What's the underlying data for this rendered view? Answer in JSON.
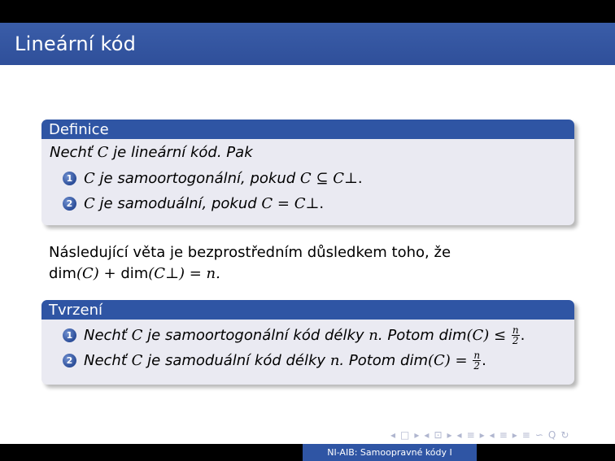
{
  "slide": {
    "title": "Lineární kód"
  },
  "definition": {
    "header": "Definice",
    "intro_text": "Nechť",
    "intro_var": "C",
    "intro_rest": "je lineární kód. Pak",
    "items": [
      {
        "num": "1",
        "var": "C",
        "text": "je samoortogonální, pokud",
        "math": "C ⊆ C⊥",
        "end": "."
      },
      {
        "num": "2",
        "var": "C",
        "text": "je samoduální, pokud",
        "math": "C = C⊥",
        "end": "."
      }
    ]
  },
  "paragraph": {
    "line1": "Následující věta je bezprostředním důsledkem toho, že",
    "line2_dim1": "dim",
    "line2_mid": "(C) + ",
    "line2_dim2": "dim",
    "line2_end": "(C⊥) = n."
  },
  "statement": {
    "header": "Tvrzení",
    "items": [
      {
        "num": "1",
        "pre": "Nechť",
        "var": "C",
        "text": "je samoortogonální kód délky",
        "n": "n",
        "post": ". Potom dim",
        "math": "(C) ≤",
        "frac_num": "n",
        "frac_den": "2",
        "end": "."
      },
      {
        "num": "2",
        "pre": "Nechť",
        "var": "C",
        "text": "je samoduální kód délky",
        "n": "n",
        "post": ". Potom dim",
        "math": "(C) =",
        "frac_num": "n",
        "frac_den": "2",
        "end": "."
      }
    ]
  },
  "footer": {
    "center": "NI-AIB: Samoopravné kódy I"
  },
  "nav": {
    "symbols": [
      "◂",
      "□",
      "▸",
      "◂",
      "⊡",
      "▸",
      "◂",
      "≡",
      "▸",
      "◂",
      "≡",
      "▸",
      "≡",
      "∽",
      "Q",
      "↻"
    ]
  }
}
